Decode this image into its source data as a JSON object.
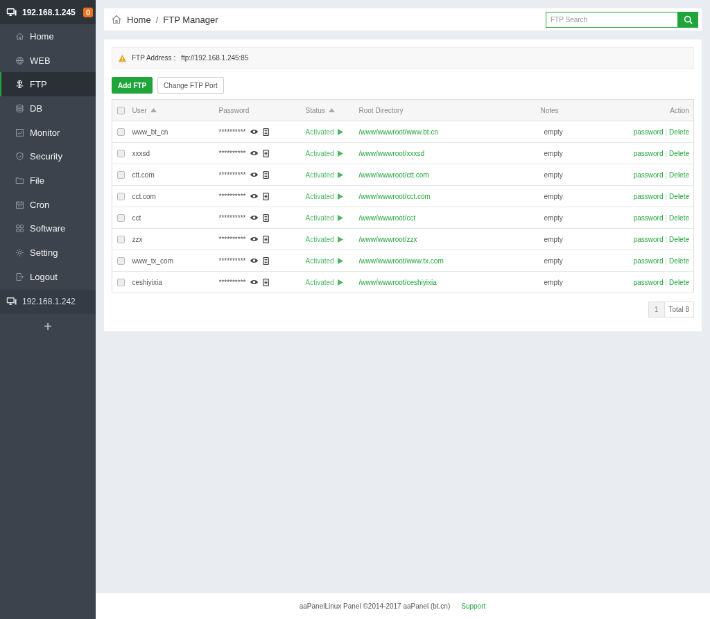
{
  "server": {
    "ip": "192.168.1.245",
    "badge": "0"
  },
  "nav": [
    {
      "label": "Home",
      "selected": false
    },
    {
      "label": "WEB",
      "selected": false
    },
    {
      "label": "FTP",
      "selected": true
    },
    {
      "label": "DB",
      "selected": false
    },
    {
      "label": "Monitor",
      "selected": false
    },
    {
      "label": "Security",
      "selected": false
    },
    {
      "label": "File",
      "selected": false
    },
    {
      "label": "Cron",
      "selected": false
    },
    {
      "label": "Software",
      "selected": false
    },
    {
      "label": "Setting",
      "selected": false
    },
    {
      "label": "Logout",
      "selected": false
    }
  ],
  "other_server": {
    "ip": "192.168.1.242"
  },
  "add_server": "+",
  "breadcrumb": {
    "items": [
      "Home",
      "FTP Manager"
    ],
    "separator": "/"
  },
  "search": {
    "placeholder": "FTP Search"
  },
  "notice": {
    "label": "FTP Address :",
    "value": "ftp://192.168.1.245:85"
  },
  "buttons": [
    {
      "label": "Add FTP",
      "kind": "primary"
    },
    {
      "label": "Change FTP Port",
      "kind": "default"
    }
  ],
  "table": {
    "select_all": {
      "checked": false
    },
    "columns": [
      {
        "label": "User",
        "sorted": true
      },
      {
        "label": "Password",
        "sorted": false
      },
      {
        "label": "Status",
        "sorted": true
      },
      {
        "label": "Root Directory",
        "sorted": false
      },
      {
        "label": "Notes",
        "sorted": false
      },
      {
        "label": "Action",
        "sorted": false
      }
    ],
    "action_separator": "|",
    "rows": [
      {
        "checked": false,
        "user": "www_bt_cn",
        "password": "**********",
        "status": "Activated",
        "root": "/www/wwwroot/www.bt.cn",
        "notes": "empty",
        "actions": [
          "password",
          "Delete"
        ]
      },
      {
        "checked": false,
        "user": "xxxsd",
        "password": "**********",
        "status": "Activated",
        "root": "/www/wwwroot/xxxsd",
        "notes": "empty",
        "actions": [
          "password",
          "Delete"
        ]
      },
      {
        "checked": false,
        "user": "ctt.com",
        "password": "**********",
        "status": "Activated",
        "root": "/www/wwwroot/ctt.com",
        "notes": "empty",
        "actions": [
          "password",
          "Delete"
        ]
      },
      {
        "checked": false,
        "user": "cct.com",
        "password": "**********",
        "status": "Activated",
        "root": "/www/wwwroot/cct.com",
        "notes": "empty",
        "actions": [
          "password",
          "Delete"
        ]
      },
      {
        "checked": false,
        "user": "cct",
        "password": "**********",
        "status": "Activated",
        "root": "/www/wwwroot/cct",
        "notes": "empty",
        "actions": [
          "password",
          "Delete"
        ]
      },
      {
        "checked": false,
        "user": "zzx",
        "password": "**********",
        "status": "Activated",
        "root": "/www/wwwroot/zzx",
        "notes": "empty",
        "actions": [
          "password",
          "Delete"
        ]
      },
      {
        "checked": false,
        "user": "www_tx_com",
        "password": "**********",
        "status": "Activated",
        "root": "/www/wwwroot/www.tx.com",
        "notes": "empty",
        "actions": [
          "password",
          "Delete"
        ]
      },
      {
        "checked": false,
        "user": "ceshiyixia",
        "password": "**********",
        "status": "Activated",
        "root": "/www/wwwroot/ceshiyixia",
        "notes": "empty",
        "actions": [
          "password",
          "Delete"
        ]
      }
    ]
  },
  "pagination": {
    "pages": [
      {
        "label": "1",
        "selected": true
      }
    ],
    "total": "Total 8"
  },
  "footer": {
    "text": "aaPanelLinux Panel ©2014-2017 aaPanel (bt.cn)",
    "link": "Support"
  }
}
